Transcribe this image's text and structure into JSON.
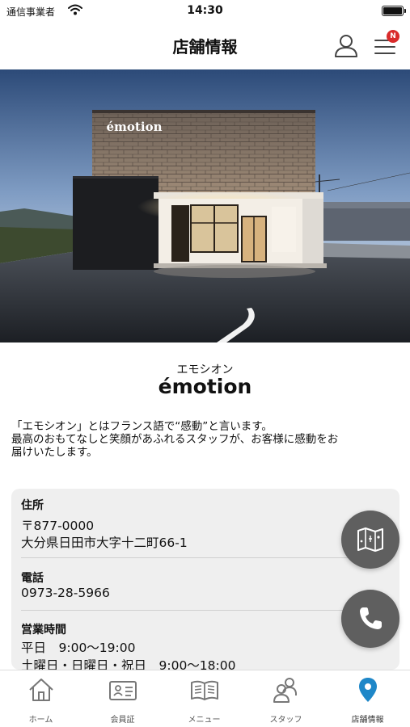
{
  "status_bar": {
    "carrier": "通信事業者",
    "time": "14:30"
  },
  "header": {
    "title": "店舗情報",
    "menu_badge": "N"
  },
  "hero": {
    "sign_text": "émotion"
  },
  "shop": {
    "kana": "エモシオン",
    "name": "émotion",
    "description_lines": [
      "「エモシオン」とはフランス語で“感動”と言います。",
      "最高のおもてなしと笑顔があふれるスタッフが、お客様に感動をお",
      "届けいたします。"
    ]
  },
  "info": {
    "address_label": "住所",
    "postal_code": "〒877-0000",
    "address": "大分県日田市大字十二町66-1",
    "phone_label": "電話",
    "phone": "0973-28-5966",
    "hours_label": "営業時間",
    "hours_weekday": "平日　9:00〜19:00",
    "hours_weekend": "土曜日・日曜日・祝日　9:00〜18:00"
  },
  "fabs": {
    "map_icon": "map-icon",
    "phone_icon": "phone-icon"
  },
  "tabs": [
    {
      "label": "ホーム",
      "icon": "home-icon"
    },
    {
      "label": "会員証",
      "icon": "member-card-icon"
    },
    {
      "label": "メニュー",
      "icon": "book-icon"
    },
    {
      "label": "スタッフ",
      "icon": "staff-icon"
    },
    {
      "label": "店舗情報",
      "icon": "location-pin-icon"
    }
  ],
  "colors": {
    "active_tab": "#1e87c8",
    "fab": "#5f5f5f",
    "badge": "#d92b2b"
  }
}
